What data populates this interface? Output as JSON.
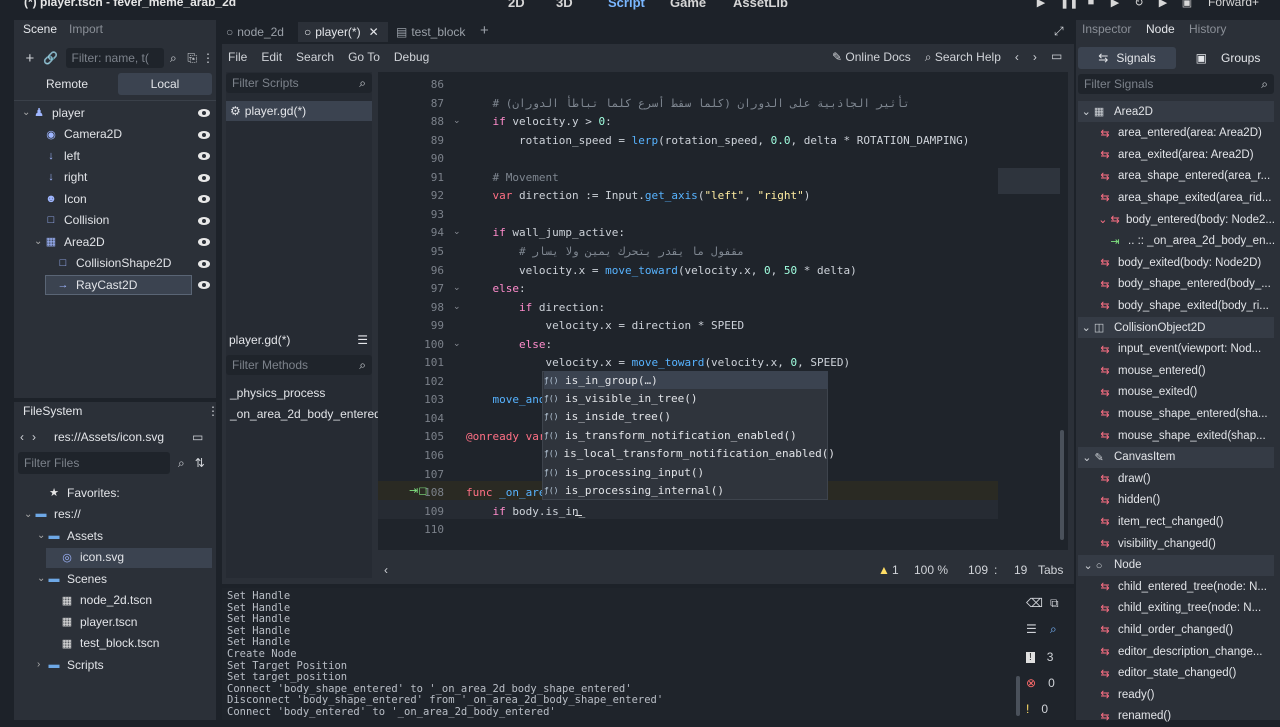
{
  "title": "(*) player.tscn - fever_meme_arab_2d",
  "workspaces": [
    "2D",
    "3D",
    "Script",
    "Game",
    "AssetLib"
  ],
  "active_workspace": "Script",
  "renderer": "Forward+",
  "scene_dock": {
    "tabs": [
      "Scene",
      "Import"
    ],
    "filter_placeholder": "Filter: name, t(",
    "remote": "Remote",
    "local": "Local",
    "nodes": [
      {
        "name": "player",
        "icon": "player-icon"
      },
      {
        "name": "Camera2D",
        "icon": "camera-icon"
      },
      {
        "name": "left",
        "icon": "arrow-down-icon"
      },
      {
        "name": "right",
        "icon": "arrow-down-icon"
      },
      {
        "name": "Icon",
        "icon": "sprite-icon"
      },
      {
        "name": "Collision",
        "icon": "square-icon"
      },
      {
        "name": "Area2D",
        "icon": "area-icon"
      },
      {
        "name": "CollisionShape2D",
        "icon": "square-icon"
      },
      {
        "name": "RayCast2D",
        "icon": "raycast-icon"
      }
    ]
  },
  "filesystem": {
    "title": "FileSystem",
    "path": "res://Assets/icon.svg",
    "filter_placeholder": "Filter Files",
    "items": [
      {
        "name": "Favorites:",
        "icon": "star-icon"
      },
      {
        "name": "res://",
        "icon": "folder-icon"
      },
      {
        "name": "Assets",
        "icon": "folder-icon"
      },
      {
        "name": "icon.svg",
        "icon": "image-icon"
      },
      {
        "name": "Scenes",
        "icon": "folder-icon"
      },
      {
        "name": "node_2d.tscn",
        "icon": "scene-icon"
      },
      {
        "name": "player.tscn",
        "icon": "scene-icon"
      },
      {
        "name": "test_block.tscn",
        "icon": "scene-icon"
      },
      {
        "name": "Scripts",
        "icon": "folder-icon"
      }
    ]
  },
  "editor_tabs": [
    "node_2d",
    "player(*)",
    "test_block"
  ],
  "menu": [
    "File",
    "Edit",
    "Search",
    "Go To",
    "Debug"
  ],
  "online_docs": "Online Docs",
  "search_help": "Search Help",
  "scripts_filter": "Filter Scripts",
  "script_item": "player.gd(*)",
  "methods_title": "player.gd(*)",
  "methods_filter": "Filter Methods",
  "methods": [
    "_physics_process",
    "_on_area_2d_body_entered"
  ],
  "code_lines": [
    {
      "n": "86",
      "html": ""
    },
    {
      "n": "87",
      "html": "<span class='cm'>    # تأثير الجاذبية على الدوران (كلما سقط أسرع كلما تباطأ الدوران)</span>"
    },
    {
      "n": "88",
      "html": "    <span class='cf'>if</span> velocity.y &gt; <span class='nm'>0</span>:"
    },
    {
      "n": "89",
      "html": "        rotation_speed = <span class='fn'>lerp</span>(rotation_speed, <span class='nm'>0.0</span>, delta * ROTATION_DAMPING)"
    },
    {
      "n": "90",
      "html": ""
    },
    {
      "n": "91",
      "html": "<span class='cm'>    # Movement</span>"
    },
    {
      "n": "92",
      "html": "    <span class='kw'>var</span> direction := Input.<span class='fn'>get_axis</span>(<span class='st'>\"left\"</span>, <span class='st'>\"right\"</span>)"
    },
    {
      "n": "93",
      "html": ""
    },
    {
      "n": "94",
      "html": "    <span class='cf'>if</span> wall_jump_active:"
    },
    {
      "n": "95",
      "html": "<span class='cm'>        # مقفول ما يقدر يتحرك يمين ولا يسار</span>"
    },
    {
      "n": "96",
      "html": "        velocity.x = <span class='fn'>move_toward</span>(velocity.x, <span class='nm'>0</span>, <span class='nm'>50</span> * delta)"
    },
    {
      "n": "97",
      "html": "    <span class='cf'>else</span>:"
    },
    {
      "n": "98",
      "html": "        <span class='cf'>if</span> direction:"
    },
    {
      "n": "99",
      "html": "            velocity.x = direction * SPEED"
    },
    {
      "n": "100",
      "html": "        <span class='cf'>else</span>:"
    },
    {
      "n": "101",
      "html": "            velocity.x = <span class='fn'>move_toward</span>(velocity.x, <span class='nm'>0</span>, SPEED)"
    },
    {
      "n": "102",
      "html": ""
    },
    {
      "n": "103",
      "html": "    <span class='fn'>move_and</span>"
    },
    {
      "n": "104",
      "html": ""
    },
    {
      "n": "105",
      "html": "<span class='kw'>@onready</span> <span class='kw'>var</span>"
    },
    {
      "n": "106",
      "html": ""
    },
    {
      "n": "107",
      "html": ""
    },
    {
      "n": "108",
      "html": "<span class='kw'>func</span> <span class='fn'>_on_are</span>"
    },
    {
      "n": "109",
      "html": "    <span class='cf'>if</span> body.is_in_"
    },
    {
      "n": "110",
      "html": ""
    }
  ],
  "autocomplete": [
    "is_in_group(…)",
    "is_visible_in_tree()",
    "is_inside_tree()",
    "is_transform_notification_enabled()",
    "is_local_transform_notification_enabled()",
    "is_processing_input()",
    "is_processing_internal()"
  ],
  "status": {
    "warnings": "1",
    "zoom": "100 %",
    "line": "109",
    "col": "19",
    "indent": "Tabs"
  },
  "output": [
    "Set Handle",
    "Set Handle",
    "Set Handle",
    "Set Handle",
    "Set Handle",
    "Create Node",
    "Set Target Position",
    "Set target_position",
    "Connect 'body_shape_entered' to '_on_area_2d_body_shape_entered'",
    "Disconnect 'body_shape_entered' from '_on_area_2d_body_shape_entered'",
    "Connect 'body_entered' to '_on_area_2d_body_entered'"
  ],
  "output_counts": {
    "errors": "3",
    "warnings": "0",
    "messages": "0"
  },
  "right_tabs": [
    "Inspector",
    "Node",
    "History"
  ],
  "signals_tab": "Signals",
  "groups_tab": "Groups",
  "filter_signals": "Filter Signals",
  "signals": [
    {
      "t": "class",
      "name": "Area2D"
    },
    {
      "t": "sig",
      "name": "area_entered(area: Area2D)"
    },
    {
      "t": "sig",
      "name": "area_exited(area: Area2D)"
    },
    {
      "t": "sig",
      "name": "area_shape_entered(area_r..."
    },
    {
      "t": "sig",
      "name": "area_shape_exited(area_rid..."
    },
    {
      "t": "sig",
      "name": "body_entered(body: Node2..."
    },
    {
      "t": "conn",
      "name": ".. :: _on_area_2d_body_en..."
    },
    {
      "t": "sig",
      "name": "body_exited(body: Node2D)"
    },
    {
      "t": "sig",
      "name": "body_shape_entered(body_..."
    },
    {
      "t": "sig",
      "name": "body_shape_exited(body_ri..."
    },
    {
      "t": "class",
      "name": "CollisionObject2D"
    },
    {
      "t": "sig",
      "name": "input_event(viewport: Nod..."
    },
    {
      "t": "sig",
      "name": "mouse_entered()"
    },
    {
      "t": "sig",
      "name": "mouse_exited()"
    },
    {
      "t": "sig",
      "name": "mouse_shape_entered(sha..."
    },
    {
      "t": "sig",
      "name": "mouse_shape_exited(shap..."
    },
    {
      "t": "class",
      "name": "CanvasItem"
    },
    {
      "t": "sig",
      "name": "draw()"
    },
    {
      "t": "sig",
      "name": "hidden()"
    },
    {
      "t": "sig",
      "name": "item_rect_changed()"
    },
    {
      "t": "sig",
      "name": "visibility_changed()"
    },
    {
      "t": "class",
      "name": "Node"
    },
    {
      "t": "sig",
      "name": "child_entered_tree(node: N..."
    },
    {
      "t": "sig",
      "name": "child_exiting_tree(node: N..."
    },
    {
      "t": "sig",
      "name": "child_order_changed()"
    },
    {
      "t": "sig",
      "name": "editor_description_change..."
    },
    {
      "t": "sig",
      "name": "editor_state_changed()"
    },
    {
      "t": "sig",
      "name": "ready()"
    },
    {
      "t": "sig",
      "name": "renamed()"
    }
  ],
  "colors": {
    "accent": "#57b3ff",
    "bg": "#1d2229",
    "panel": "#2b3038",
    "signal": "#ff7085"
  }
}
